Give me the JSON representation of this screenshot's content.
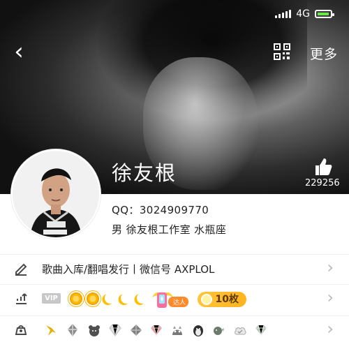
{
  "status": {
    "network": "4G"
  },
  "header": {
    "more_label": "更多",
    "like_count": "229256"
  },
  "profile": {
    "name": "徐友根",
    "qq": "QQ：3024909770",
    "details": "男  徐友根工作室  水瓶座"
  },
  "rows": {
    "music_text": "歌曲入库/翻唱发行丨微信号 AXPLOL",
    "vip_label": "VIP",
    "talent_label": "达人",
    "coin_label": "10枚"
  },
  "colors": {
    "accent_gold": "#ffb31f",
    "text_primary": "#242424",
    "chevron_gray": "#b9b9b9"
  },
  "icons": {
    "back": "chevron-left-icon",
    "qr": "qr-code-icon",
    "like": "thumbs-up-icon",
    "edit": "pencil-icon",
    "level": "level-icon",
    "gift": "gift-bag-icon"
  }
}
